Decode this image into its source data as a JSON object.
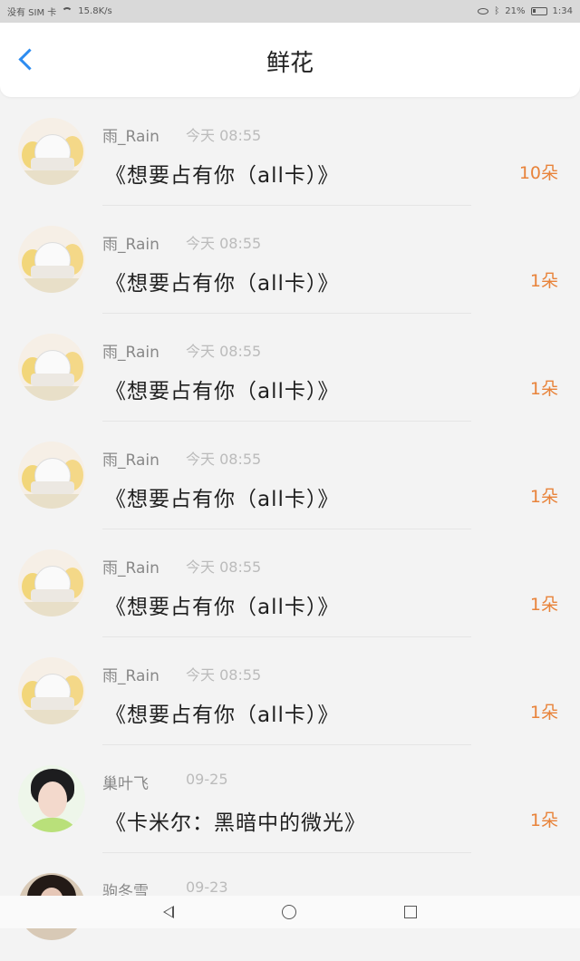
{
  "status_bar": {
    "carrier": "没有 SIM 卡",
    "speed": "15.8K/s",
    "battery": "21%",
    "time": "1:34"
  },
  "header": {
    "title": "鲜花"
  },
  "list": [
    {
      "name": "雨_Rain",
      "time": "今天 08:55",
      "work": "《想要占有你（all卡）》",
      "count": "10朵"
    },
    {
      "name": "雨_Rain",
      "time": "今天 08:55",
      "work": "《想要占有你（all卡）》",
      "count": "1朵"
    },
    {
      "name": "雨_Rain",
      "time": "今天 08:55",
      "work": "《想要占有你（all卡）》",
      "count": "1朵"
    },
    {
      "name": "雨_Rain",
      "time": "今天 08:55",
      "work": "《想要占有你（all卡）》",
      "count": "1朵"
    },
    {
      "name": "雨_Rain",
      "time": "今天 08:55",
      "work": "《想要占有你（all卡）》",
      "count": "1朵"
    },
    {
      "name": "雨_Rain",
      "time": "今天 08:55",
      "work": "《想要占有你（all卡）》",
      "count": "1朵"
    },
    {
      "name": "巢叶飞",
      "time": "09-25",
      "work": "《卡米尔：黑暗中的微光》",
      "count": "1朵"
    },
    {
      "name": "驹冬雪",
      "time": "09-23",
      "work": "",
      "count": ""
    }
  ],
  "colors": {
    "accent": "#2d8cf0",
    "count": "#e8833a"
  }
}
